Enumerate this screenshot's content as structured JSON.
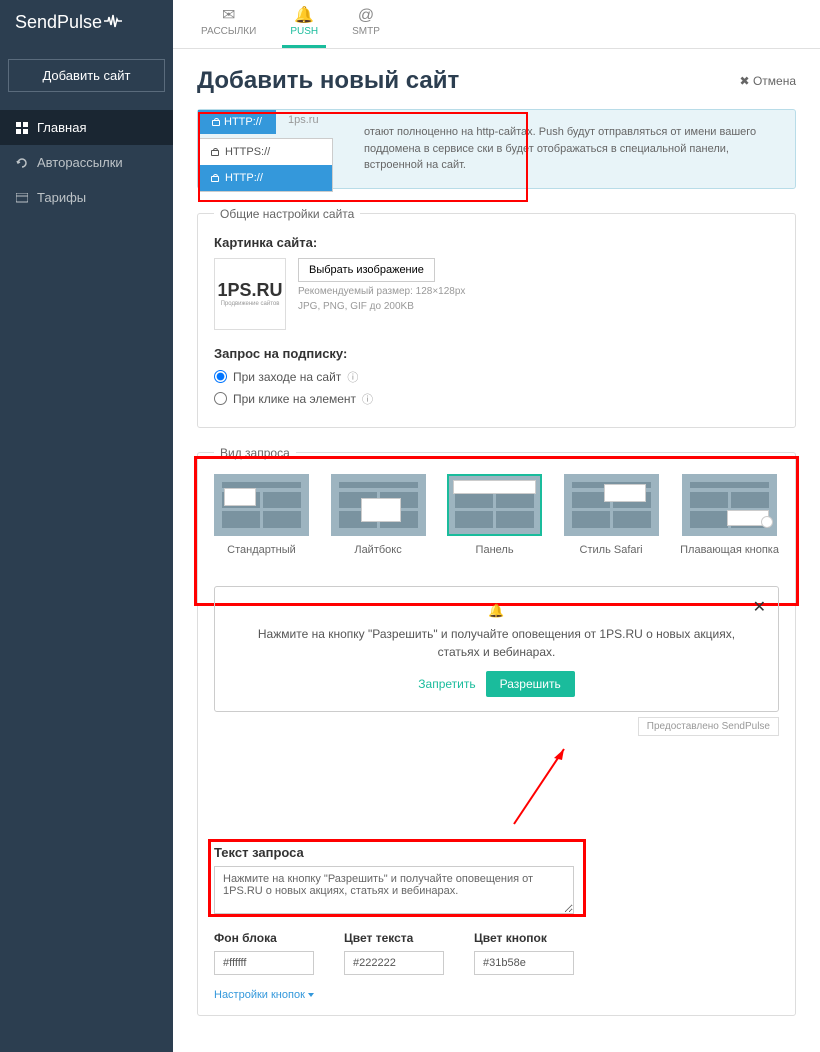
{
  "brand": "SendPulse",
  "sidebar": {
    "add_site": "Добавить сайт",
    "items": [
      {
        "label": "Главная"
      },
      {
        "label": "Авторассылки"
      },
      {
        "label": "Тарифы"
      }
    ]
  },
  "topnav": {
    "items": [
      {
        "label": "РАССЫЛКИ"
      },
      {
        "label": "PUSH"
      },
      {
        "label": "SMTP"
      }
    ]
  },
  "page": {
    "title": "Добавить новый сайт",
    "cancel": "Отмена"
  },
  "protocol": {
    "active_tab": "HTTP://",
    "site_placeholder": "1ps.ru",
    "options": [
      {
        "label": "HTTPS://"
      },
      {
        "label": "HTTP://"
      }
    ],
    "info_text": "отают полноценно на http-сайтах. Push будут отправляться от имени вашего поддомена в сервисе ски в будет отображаться в специальной панели, встроенной на сайт."
  },
  "general": {
    "legend": "Общие настройки сайта",
    "image_label": "Картинка сайта:",
    "logo_main": "1PS",
    "logo_suffix": ".RU",
    "logo_sub": "Продвижение сайтов",
    "select_image": "Выбрать изображение",
    "hint1": "Рекомендуемый размер: 128×128px",
    "hint2": "JPG, PNG, GIF до 200KB",
    "subscribe_label": "Запрос на подписку:",
    "radio1": "При заходе на сайт",
    "radio2": "При клике на элемент"
  },
  "request": {
    "legend": "Вид запроса",
    "types": [
      {
        "label": "Стандартный"
      },
      {
        "label": "Лайтбокс"
      },
      {
        "label": "Панель"
      },
      {
        "label": "Стиль Safari"
      },
      {
        "label": "Плавающая кнопка"
      }
    ],
    "preview_text": "Нажмите на кнопку \"Разрешить\" и получайте оповещения от 1PS.RU о новых акциях, статьях и вебинарах.",
    "deny": "Запретить",
    "allow": "Разрешить",
    "provided_by": "Предоставлено SendPulse",
    "text_label": "Текст запроса",
    "text_value": "Нажмите на кнопку \"Разрешить\" и получайте оповещения от 1PS.RU о новых акциях, статьях и вебинарах.",
    "colors": {
      "block_label": "Фон блока",
      "block_value": "#ffffff",
      "text_label": "Цвет текста",
      "text_value": "#222222",
      "buttons_label": "Цвет кнопок",
      "buttons_value": "#31b58e"
    },
    "button_settings": "Настройки кнопок"
  }
}
